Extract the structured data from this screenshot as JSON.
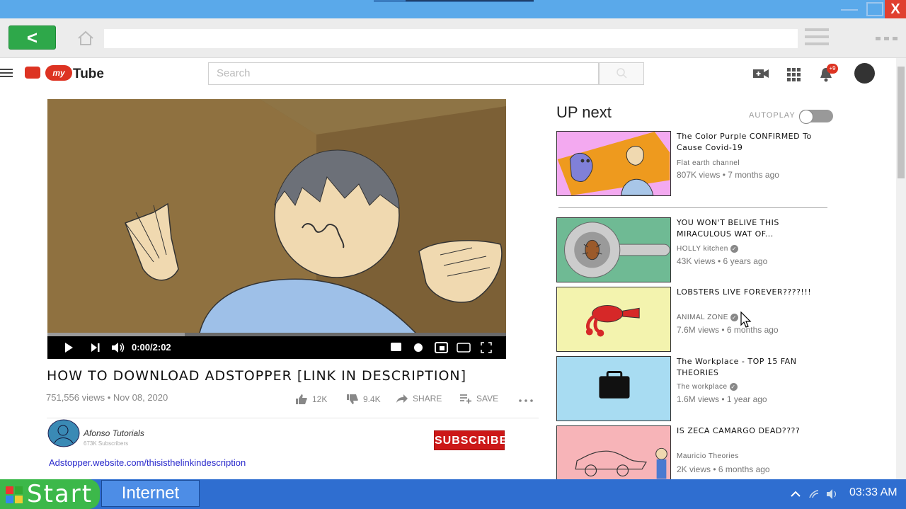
{
  "browser": {
    "back_label": "<",
    "address_value": "",
    "close_label": "X"
  },
  "header": {
    "logo_badge": "my",
    "logo_text": "Tube",
    "search_placeholder": "Search",
    "notification_count": "+9"
  },
  "player": {
    "time": "0:00/2:02",
    "buffered_fraction": 0.3
  },
  "video": {
    "title": "HOW TO DOWNLOAD ADSTOPPER [LINK IN DESCRIPTION]",
    "meta": "751,556 views • Nov 08, 2020",
    "likes": "12K",
    "dislikes": "9.4K",
    "share_label": "SHARE",
    "save_label": "SAVE",
    "channel_name": "Afonso Tutorials",
    "channel_subs": "673K Subscribers",
    "subscribe_label": "SUBSCRIBE",
    "description_link": "Adstopper.website.com/thisisthelinkindescription"
  },
  "sidebar": {
    "heading": "UP next",
    "autoplay_label": "AUTOPLAY",
    "items": [
      {
        "title": "The Color Purple CONFIRMED To Cause Covid-19",
        "channel": "Flat earth channel",
        "meta": "807K views • 7 months ago",
        "verified": false
      },
      {
        "title": "YOU WON'T BELIVE THIS MIRACULOUS WAT OF...",
        "channel": "HOLLY kitchen",
        "meta": "43K views • 6 years ago",
        "verified": true
      },
      {
        "title": "LOBSTERS LIVE FOREVER????!!!",
        "channel": "ANIMAL ZONE",
        "meta": "7.6M views • 6 months ago",
        "verified": true
      },
      {
        "title": "The Workplace - TOP 15 FAN THEORIES",
        "channel": "The workplace",
        "meta": "1.6M views • 1 year ago",
        "verified": true
      },
      {
        "title": "IS ZECA CAMARGO DEAD????",
        "channel": "Mauricio Theories",
        "meta": "2K views • 6 months ago",
        "verified": false
      }
    ]
  },
  "taskbar": {
    "start_label": "Start",
    "task_label": "Internet",
    "clock": "03:33 AM"
  },
  "colors": {
    "titlebar": "#5aa9ea",
    "back_button": "#2ea84a",
    "subscribe": "#cc1818",
    "taskbar": "#2f6ed0",
    "start": "#3cb84a"
  }
}
